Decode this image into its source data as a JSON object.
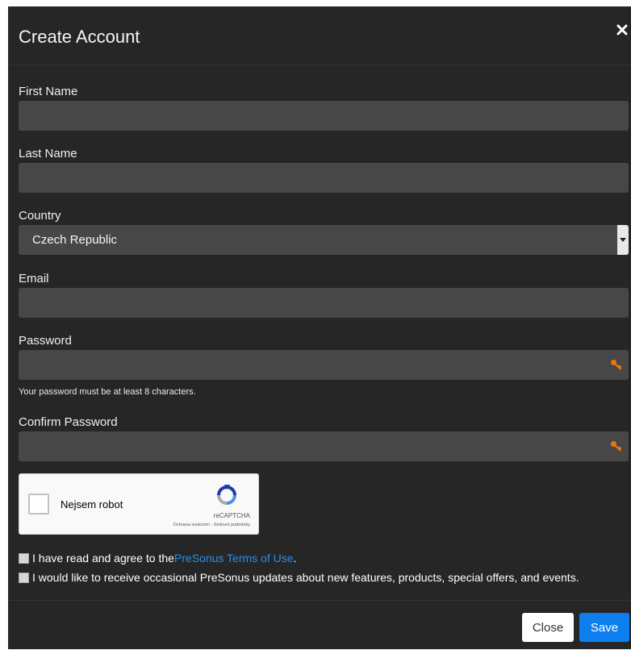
{
  "dialog": {
    "title": "Create Account"
  },
  "form": {
    "first_name": {
      "label": "First Name",
      "value": "",
      "placeholder": ""
    },
    "last_name": {
      "label": "Last Name",
      "value": "",
      "placeholder": ""
    },
    "country": {
      "label": "Country",
      "selected": "Czech Republic"
    },
    "email": {
      "label": "Email",
      "value": "",
      "placeholder": ""
    },
    "password": {
      "label": "Password",
      "value": "",
      "help": "Your password must be at least 8 characters."
    },
    "confirm_password": {
      "label": "Confirm Password",
      "value": ""
    }
  },
  "captcha": {
    "label": "Nejsem robot",
    "brand": "reCAPTCHA",
    "links": "Ochrana soukromí - Smluvní podmínky"
  },
  "agreements": {
    "terms_prefix": "I have read and agree to the ",
    "terms_link": "PreSonus Terms of Use",
    "terms_suffix": ".",
    "updates": "I would like to receive occasional PreSonus updates about new features, products, special offers, and events."
  },
  "footer": {
    "close_label": "Close",
    "save_label": "Save"
  },
  "colors": {
    "dialog_bg": "#262626",
    "input_bg": "#474747",
    "key_icon": "#e8760c",
    "link": "#2b8fe6",
    "save_button": "#0d7ef0"
  },
  "icons": {
    "close": "close-icon",
    "key": "key-icon",
    "select_arrow": "caret-down-icon",
    "recaptcha": "recaptcha-logo-icon"
  }
}
